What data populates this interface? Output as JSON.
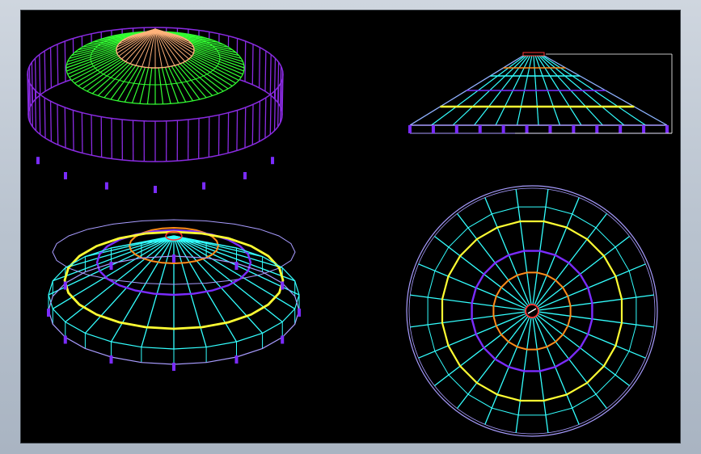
{
  "canvas": {
    "background": "#000000",
    "window_background": "#c4ccd6"
  },
  "colors": {
    "purple": "#8a2be2",
    "violet": "#7b2cff",
    "green": "#33ff33",
    "peach": "#ffb27a",
    "cyan": "#33ffff",
    "yellow": "#ffff33",
    "orange": "#ff8c1a",
    "lavender": "#a89cff",
    "red": "#ff3333",
    "white": "#ffffff"
  },
  "views": [
    {
      "name": "iso-view-rendered",
      "kind": "isometric",
      "rafters": 72,
      "rings": [
        "peach-cap",
        "green-band",
        "purple-band"
      ],
      "columns": 16
    },
    {
      "name": "elevation-view",
      "kind": "side-elevation",
      "columns": 12,
      "dimension": "height"
    },
    {
      "name": "iso-view-wireframe",
      "kind": "isometric",
      "rafters": 24,
      "rings": [
        "orange",
        "purple",
        "yellow"
      ],
      "columns": 12
    },
    {
      "name": "plan-view",
      "kind": "top-plan",
      "rafters": 24,
      "rings": [
        "red-hub",
        "orange",
        "purple",
        "yellow",
        "outer"
      ]
    }
  ]
}
